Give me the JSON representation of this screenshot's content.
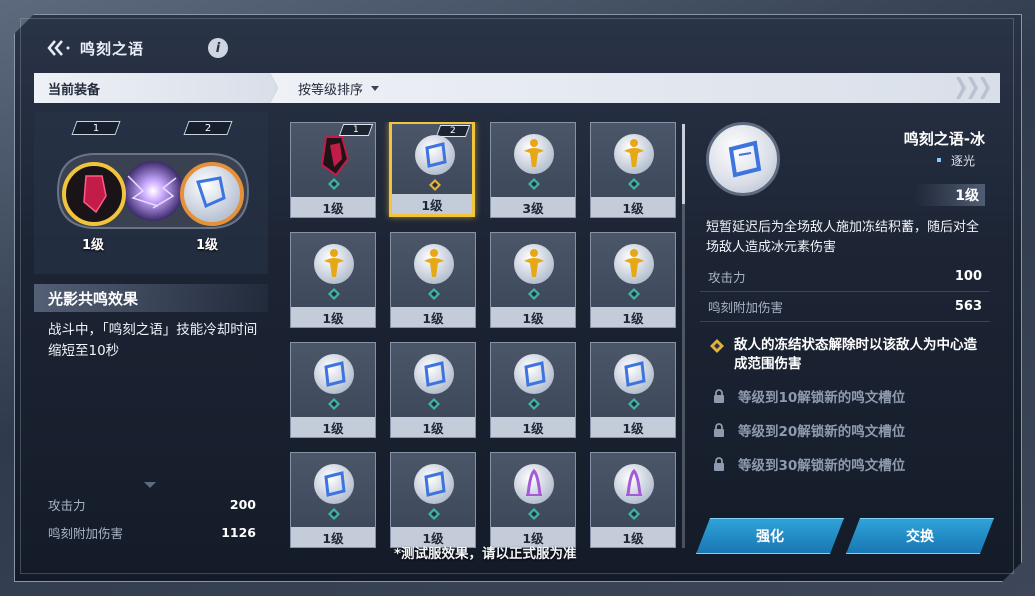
{
  "header": {
    "title": "鸣刻之语"
  },
  "tabs": {
    "equipped": "当前装备",
    "sort": "按等级排序"
  },
  "equipped": {
    "slots": [
      {
        "number": "1",
        "level": "1级",
        "element": "dark"
      },
      {
        "number": "2",
        "level": "1级",
        "element": "ice"
      }
    ]
  },
  "resonance": {
    "title": "光影共鸣效果",
    "description": "战斗中，「鸣刻之语」技能冷却时间缩短至10秒"
  },
  "left_stats": [
    {
      "label": "攻击力",
      "value": "200"
    },
    {
      "label": "鸣刻附加伤害",
      "value": "1126"
    }
  ],
  "grid": [
    {
      "level": "1级",
      "element": "dark",
      "tag": "1",
      "rune": "teal"
    },
    {
      "level": "1级",
      "element": "ice",
      "tag": "2",
      "rune": "gold",
      "selected": true
    },
    {
      "level": "3级",
      "element": "gold",
      "rune": "teal"
    },
    {
      "level": "1级",
      "element": "gold",
      "rune": "teal"
    },
    {
      "level": "1级",
      "element": "gold",
      "rune": "teal"
    },
    {
      "level": "1级",
      "element": "gold",
      "rune": "teal"
    },
    {
      "level": "1级",
      "element": "gold",
      "rune": "teal"
    },
    {
      "level": "1级",
      "element": "gold",
      "rune": "teal"
    },
    {
      "level": "1级",
      "element": "ice",
      "rune": "teal"
    },
    {
      "level": "1级",
      "element": "ice",
      "rune": "teal"
    },
    {
      "level": "1级",
      "element": "ice",
      "rune": "teal"
    },
    {
      "level": "1级",
      "element": "ice",
      "rune": "teal"
    },
    {
      "level": "1级",
      "element": "ice",
      "rune": "teal"
    },
    {
      "level": "1级",
      "element": "ice",
      "rune": "teal"
    },
    {
      "level": "1级",
      "element": "purple",
      "rune": "teal"
    },
    {
      "level": "1级",
      "element": "purple",
      "rune": "teal"
    }
  ],
  "detail": {
    "name": "鸣刻之语-冰",
    "subtitle": "逐光",
    "level": "1级",
    "description": "短暂延迟后为全场敌人施加冻结积蓄，随后对全场敌人造成冰元素伤害",
    "stats": [
      {
        "label": "攻击力",
        "value": "100"
      },
      {
        "label": "鸣刻附加伤害",
        "value": "563"
      }
    ],
    "effect": "敌人的冻结状态解除时以该敌人为中心造成范围伤害",
    "locked": [
      "等级到10解锁新的鸣文槽位",
      "等级到20解锁新的鸣文槽位",
      "等级到30解锁新的鸣文槽位"
    ]
  },
  "buttons": {
    "upgrade": "强化",
    "swap": "交换"
  },
  "footnote": "*测试服效果，请以正式服为准",
  "colors": {
    "selected": "#f2c43b",
    "button": "#2a8fc9",
    "ice": "#3d74e0",
    "gold": "#e6a817",
    "purple": "#a55bd8",
    "rune_teal": "#3fb6a3",
    "rune_gold": "#e2b23a"
  }
}
